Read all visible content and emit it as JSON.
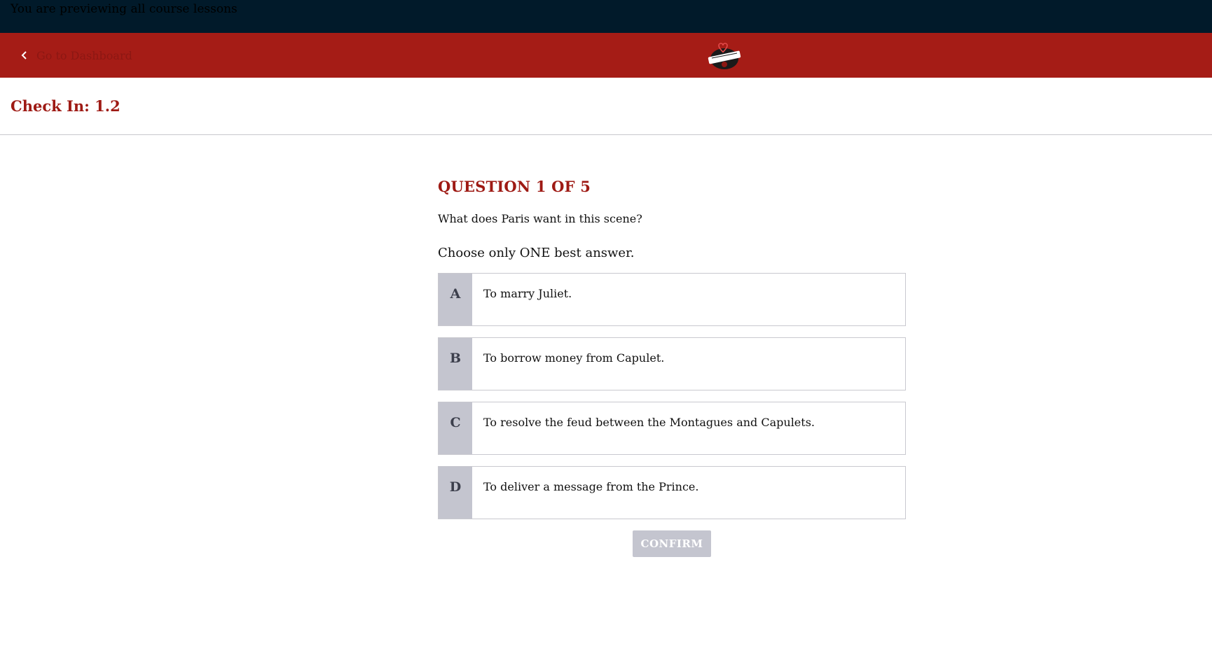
{
  "preview_bar": {
    "text": "You are previewing all course lessons"
  },
  "header": {
    "back_label": "Go to Dashboard",
    "colors": {
      "bar": "#a51c16",
      "link": "#8c1713"
    },
    "logo_icon": "romeo-juliet-logo-icon"
  },
  "page": {
    "title": "Check In: 1.2"
  },
  "quiz": {
    "counter": "QUESTION 1 OF 5",
    "question": "What does Paris want in this scene?",
    "instruction": "Choose only ONE best answer.",
    "options": [
      {
        "letter": "A",
        "text": "To marry Juliet."
      },
      {
        "letter": "B",
        "text": "To borrow money from Capulet."
      },
      {
        "letter": "C",
        "text": "To resolve the feud between the Montagues and Capulets."
      },
      {
        "letter": "D",
        "text": "To deliver a message from the Prince."
      }
    ],
    "confirm_label": "CONFIRM"
  }
}
